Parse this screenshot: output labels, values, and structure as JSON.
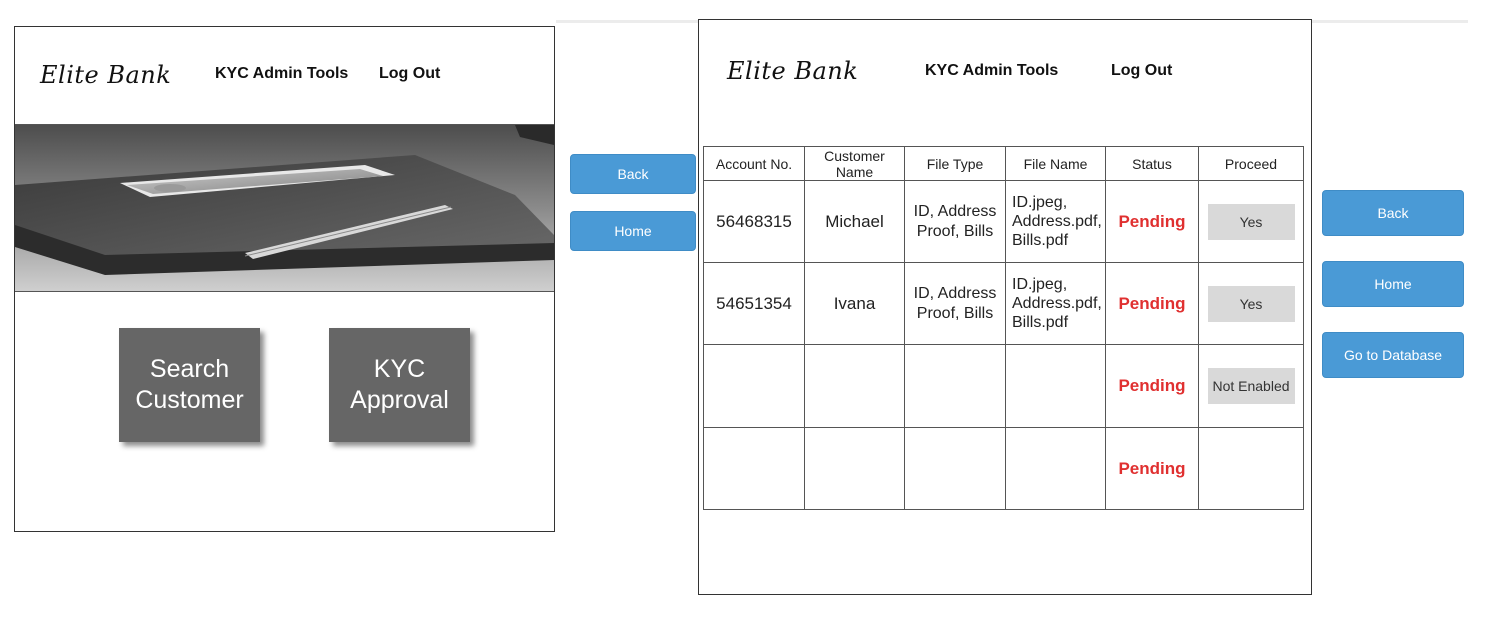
{
  "left_screen": {
    "logo": "Elite Bank",
    "nav": {
      "admin_tools": "KYC Admin Tools",
      "logout": "Log Out"
    },
    "tiles": {
      "search": "Search\nCustomer",
      "kyc": "KYC\nApproval"
    }
  },
  "middle_buttons": {
    "back": "Back",
    "home": "Home"
  },
  "right_screen": {
    "logo": "Elite Bank",
    "nav": {
      "admin_tools": "KYC Admin Tools",
      "logout": "Log Out"
    },
    "table": {
      "headers": [
        "Account No.",
        "Customer Name",
        "File Type",
        "File Name",
        "Status",
        "Proceed"
      ],
      "rows": [
        {
          "account": "56468315",
          "name": "Michael",
          "file_type": "ID, Address\nProof, Bills",
          "file_name": "ID.jpeg,\nAddress.pdf,\nBills.pdf",
          "status": "Pending",
          "proceed": "Yes"
        },
        {
          "account": "54651354",
          "name": "Ivana",
          "file_type": "ID, Address\nProof, Bills",
          "file_name": "ID.jpeg,\nAddress.pdf,\nBills.pdf",
          "status": "Pending",
          "proceed": "Yes"
        },
        {
          "account": "",
          "name": "",
          "file_type": "",
          "file_name": "",
          "status": "Pending",
          "proceed": "Not Enabled"
        },
        {
          "account": "",
          "name": "",
          "file_type": "",
          "file_name": "",
          "status": "Pending",
          "proceed": ""
        }
      ]
    }
  },
  "right_buttons": {
    "back": "Back",
    "home": "Home",
    "database": "Go to Database"
  },
  "colors": {
    "button_blue": "#4a9ad6",
    "tile_gray": "#666666",
    "status_red": "#e03030",
    "proceed_gray": "#d9d9d9"
  }
}
